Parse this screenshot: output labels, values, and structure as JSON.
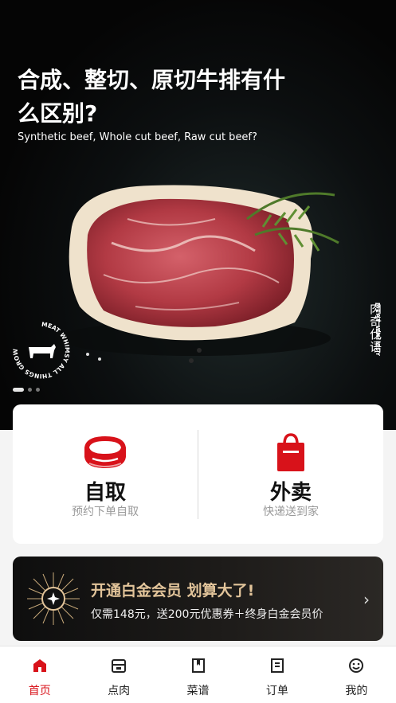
{
  "hero": {
    "title": "合成、整切、原切牛排有什么区别?",
    "subtitle": "Synthetic beef, Whole cut beef, Raw cut beef?",
    "brand_ring_text": "MEAT WHIMSY ALL THINGS GROW",
    "brand_cn": "肉奇伐语",
    "brand_en": "MEAT WHIMSY",
    "carousel_total": 3,
    "carousel_active": 1
  },
  "services": {
    "pickup": {
      "title": "自取",
      "subtitle": "预约下单自取",
      "icon": "steak-icon"
    },
    "delivery": {
      "title": "外卖",
      "subtitle": "快递送到家",
      "icon": "shopping-bag-icon"
    }
  },
  "vip": {
    "title": "开通白金会员 划算大了!",
    "subtitle": "仅需148元，送200元优惠券＋终身白金会员价",
    "arrow": "›",
    "badge_icon": "star-badge-icon"
  },
  "tabbar": {
    "items": [
      {
        "label": "首页",
        "icon": "home-icon",
        "active": true
      },
      {
        "label": "点肉",
        "icon": "shop-icon",
        "active": false
      },
      {
        "label": "菜谱",
        "icon": "recipe-book-icon",
        "active": false
      },
      {
        "label": "订单",
        "icon": "order-icon",
        "active": false
      },
      {
        "label": "我的",
        "icon": "profile-smile-icon",
        "active": false
      }
    ]
  },
  "colors": {
    "accent": "#d8121a",
    "gold": "#e2c49a",
    "vip_bg": "#1d1b19"
  }
}
